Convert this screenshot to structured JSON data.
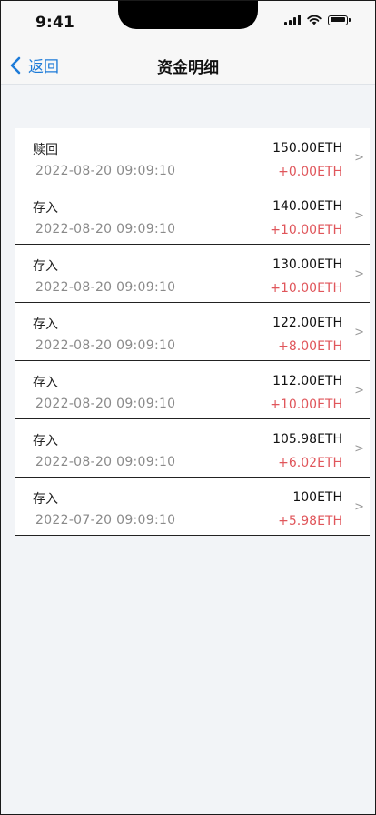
{
  "status_bar": {
    "time": "9:41",
    "icons": [
      "signal-icon",
      "wifi-icon",
      "battery-icon"
    ]
  },
  "nav": {
    "back_label": "返回",
    "title": "资金明细",
    "back_icon": "chevron-left-icon"
  },
  "colors": {
    "accent": "#1d7bd8",
    "positive_change": "#e0565b",
    "date_text": "#8a8a8a",
    "background": "#f2f4f7"
  },
  "records": [
    {
      "type": "赎回",
      "date": "2022-08-20 09:09:10",
      "balance": "150.00ETH",
      "change": "+0.00ETH"
    },
    {
      "type": "存入",
      "date": "2022-08-20 09:09:10",
      "balance": "140.00ETH",
      "change": "+10.00ETH"
    },
    {
      "type": "存入",
      "date": "2022-08-20 09:09:10",
      "balance": "130.00ETH",
      "change": "+10.00ETH"
    },
    {
      "type": "存入",
      "date": "2022-08-20 09:09:10",
      "balance": "122.00ETH",
      "change": "+8.00ETH"
    },
    {
      "type": "存入",
      "date": "2022-08-20 09:09:10",
      "balance": "112.00ETH",
      "change": "+10.00ETH"
    },
    {
      "type": "存入",
      "date": "2022-08-20 09:09:10",
      "balance": "105.98ETH",
      "change": "+6.02ETH"
    },
    {
      "type": "存入",
      "date": "2022-07-20 09:09:10",
      "balance": "100ETH",
      "change": "+5.98ETH"
    }
  ],
  "chevron_glyph": ">"
}
